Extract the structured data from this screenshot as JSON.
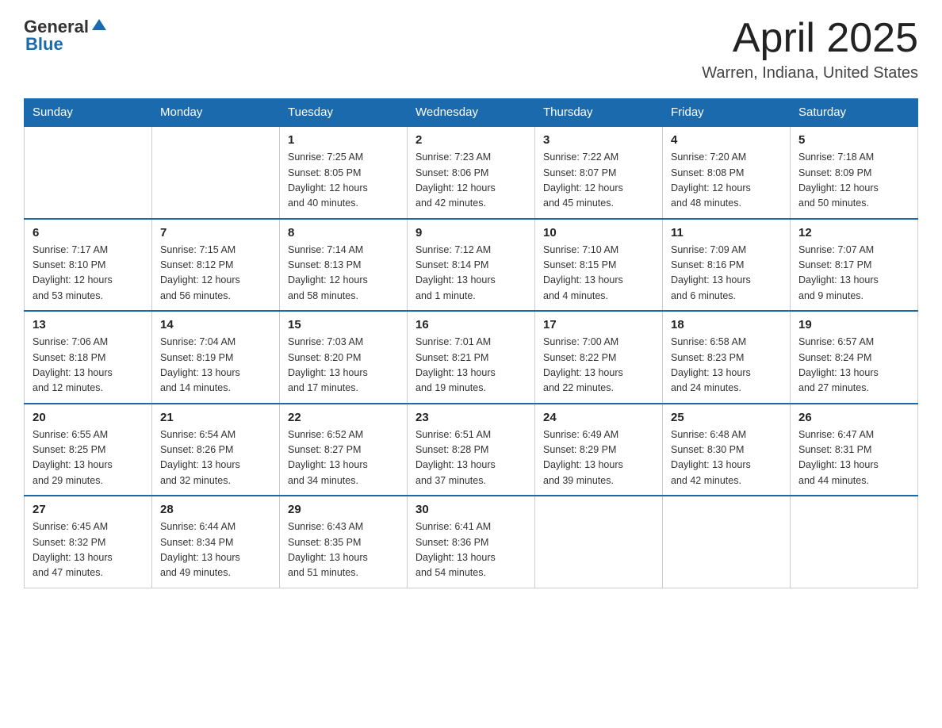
{
  "header": {
    "logo_general": "General",
    "logo_blue": "Blue",
    "month_title": "April 2025",
    "location": "Warren, Indiana, United States"
  },
  "days_of_week": [
    "Sunday",
    "Monday",
    "Tuesday",
    "Wednesday",
    "Thursday",
    "Friday",
    "Saturday"
  ],
  "weeks": [
    [
      {
        "day": "",
        "info": ""
      },
      {
        "day": "",
        "info": ""
      },
      {
        "day": "1",
        "info": "Sunrise: 7:25 AM\nSunset: 8:05 PM\nDaylight: 12 hours\nand 40 minutes."
      },
      {
        "day": "2",
        "info": "Sunrise: 7:23 AM\nSunset: 8:06 PM\nDaylight: 12 hours\nand 42 minutes."
      },
      {
        "day": "3",
        "info": "Sunrise: 7:22 AM\nSunset: 8:07 PM\nDaylight: 12 hours\nand 45 minutes."
      },
      {
        "day": "4",
        "info": "Sunrise: 7:20 AM\nSunset: 8:08 PM\nDaylight: 12 hours\nand 48 minutes."
      },
      {
        "day": "5",
        "info": "Sunrise: 7:18 AM\nSunset: 8:09 PM\nDaylight: 12 hours\nand 50 minutes."
      }
    ],
    [
      {
        "day": "6",
        "info": "Sunrise: 7:17 AM\nSunset: 8:10 PM\nDaylight: 12 hours\nand 53 minutes."
      },
      {
        "day": "7",
        "info": "Sunrise: 7:15 AM\nSunset: 8:12 PM\nDaylight: 12 hours\nand 56 minutes."
      },
      {
        "day": "8",
        "info": "Sunrise: 7:14 AM\nSunset: 8:13 PM\nDaylight: 12 hours\nand 58 minutes."
      },
      {
        "day": "9",
        "info": "Sunrise: 7:12 AM\nSunset: 8:14 PM\nDaylight: 13 hours\nand 1 minute."
      },
      {
        "day": "10",
        "info": "Sunrise: 7:10 AM\nSunset: 8:15 PM\nDaylight: 13 hours\nand 4 minutes."
      },
      {
        "day": "11",
        "info": "Sunrise: 7:09 AM\nSunset: 8:16 PM\nDaylight: 13 hours\nand 6 minutes."
      },
      {
        "day": "12",
        "info": "Sunrise: 7:07 AM\nSunset: 8:17 PM\nDaylight: 13 hours\nand 9 minutes."
      }
    ],
    [
      {
        "day": "13",
        "info": "Sunrise: 7:06 AM\nSunset: 8:18 PM\nDaylight: 13 hours\nand 12 minutes."
      },
      {
        "day": "14",
        "info": "Sunrise: 7:04 AM\nSunset: 8:19 PM\nDaylight: 13 hours\nand 14 minutes."
      },
      {
        "day": "15",
        "info": "Sunrise: 7:03 AM\nSunset: 8:20 PM\nDaylight: 13 hours\nand 17 minutes."
      },
      {
        "day": "16",
        "info": "Sunrise: 7:01 AM\nSunset: 8:21 PM\nDaylight: 13 hours\nand 19 minutes."
      },
      {
        "day": "17",
        "info": "Sunrise: 7:00 AM\nSunset: 8:22 PM\nDaylight: 13 hours\nand 22 minutes."
      },
      {
        "day": "18",
        "info": "Sunrise: 6:58 AM\nSunset: 8:23 PM\nDaylight: 13 hours\nand 24 minutes."
      },
      {
        "day": "19",
        "info": "Sunrise: 6:57 AM\nSunset: 8:24 PM\nDaylight: 13 hours\nand 27 minutes."
      }
    ],
    [
      {
        "day": "20",
        "info": "Sunrise: 6:55 AM\nSunset: 8:25 PM\nDaylight: 13 hours\nand 29 minutes."
      },
      {
        "day": "21",
        "info": "Sunrise: 6:54 AM\nSunset: 8:26 PM\nDaylight: 13 hours\nand 32 minutes."
      },
      {
        "day": "22",
        "info": "Sunrise: 6:52 AM\nSunset: 8:27 PM\nDaylight: 13 hours\nand 34 minutes."
      },
      {
        "day": "23",
        "info": "Sunrise: 6:51 AM\nSunset: 8:28 PM\nDaylight: 13 hours\nand 37 minutes."
      },
      {
        "day": "24",
        "info": "Sunrise: 6:49 AM\nSunset: 8:29 PM\nDaylight: 13 hours\nand 39 minutes."
      },
      {
        "day": "25",
        "info": "Sunrise: 6:48 AM\nSunset: 8:30 PM\nDaylight: 13 hours\nand 42 minutes."
      },
      {
        "day": "26",
        "info": "Sunrise: 6:47 AM\nSunset: 8:31 PM\nDaylight: 13 hours\nand 44 minutes."
      }
    ],
    [
      {
        "day": "27",
        "info": "Sunrise: 6:45 AM\nSunset: 8:32 PM\nDaylight: 13 hours\nand 47 minutes."
      },
      {
        "day": "28",
        "info": "Sunrise: 6:44 AM\nSunset: 8:34 PM\nDaylight: 13 hours\nand 49 minutes."
      },
      {
        "day": "29",
        "info": "Sunrise: 6:43 AM\nSunset: 8:35 PM\nDaylight: 13 hours\nand 51 minutes."
      },
      {
        "day": "30",
        "info": "Sunrise: 6:41 AM\nSunset: 8:36 PM\nDaylight: 13 hours\nand 54 minutes."
      },
      {
        "day": "",
        "info": ""
      },
      {
        "day": "",
        "info": ""
      },
      {
        "day": "",
        "info": ""
      }
    ]
  ]
}
